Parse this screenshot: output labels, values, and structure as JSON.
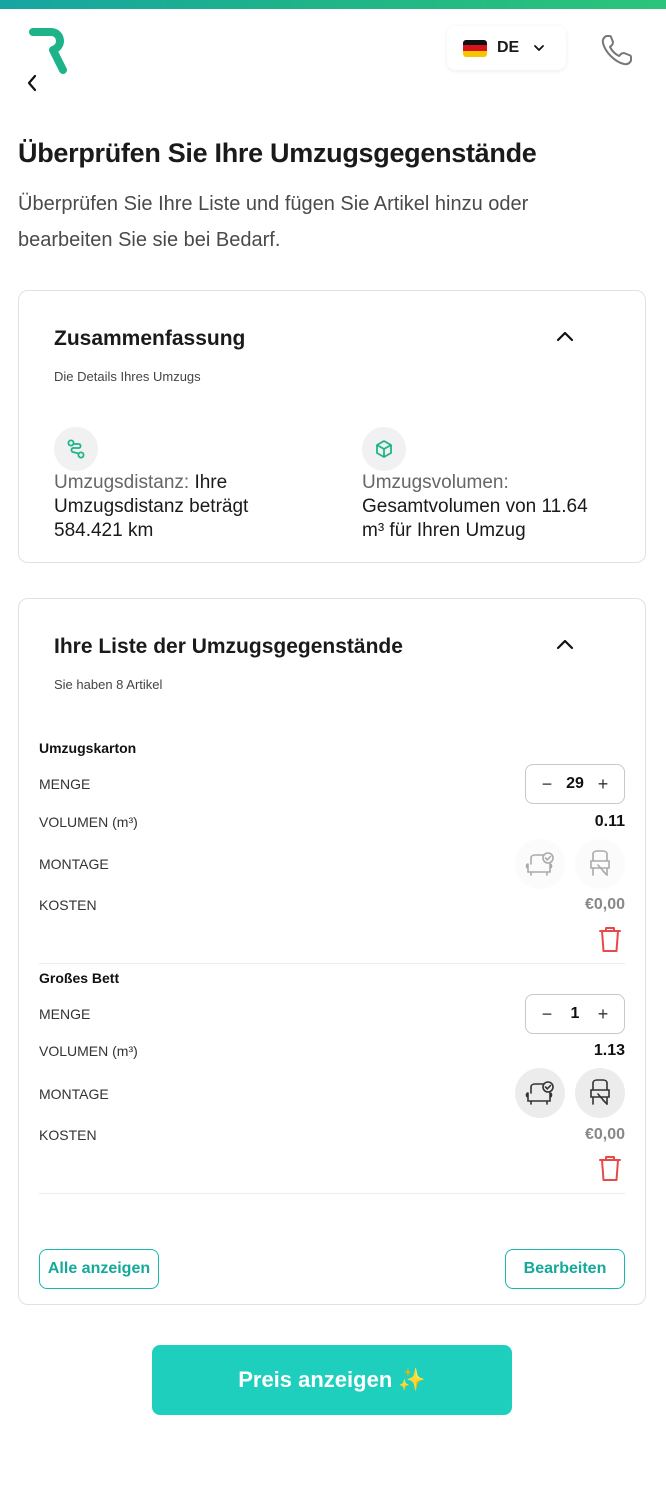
{
  "header": {
    "logo_letter": "R",
    "brand_color": "#1fb389",
    "language": {
      "code": "DE",
      "flag": "germany-flag-icon"
    },
    "back_icon": "chevron-left-icon",
    "phone_icon": "phone-icon"
  },
  "page": {
    "title": "Überprüfen Sie Ihre Umzugsgegenstände",
    "subtitle": "Überprüfen Sie Ihre Liste und fügen Sie Artikel hinzu oder bearbeiten Sie sie bei Bedarf."
  },
  "summary": {
    "title": "Zusammenfassung",
    "subtitle": "Die Details Ihres Umzugs",
    "distance_label": "Umzugsdistanz:",
    "distance_text": " Ihre Umzugsdistanz beträgt 584.421 km",
    "volume_label": "Umzugsvolumen:",
    "volume_text": " Gesamtvolumen von 11.64 m³ für Ihren Umzug"
  },
  "items_list": {
    "title": "Ihre Liste der Umzugsgegenstände",
    "subtitle": "Sie haben 8 Artikel",
    "labels": {
      "quantity": "MENGE",
      "volume": "VOLUMEN (m³)",
      "assembly": "MONTAGE",
      "cost": "KOSTEN"
    },
    "items": [
      {
        "name": "Umzugskarton",
        "quantity": "29",
        "volume": "0.11",
        "cost": "€0,00",
        "assembly_enabled": false
      },
      {
        "name": "Großes Bett",
        "quantity": "1",
        "volume": "1.13",
        "cost": "€0,00",
        "assembly_enabled": true
      }
    ],
    "show_all_label": "Alle anzeigen",
    "edit_label": "Bearbeiten"
  },
  "cta": {
    "label": "Preis anzeigen ✨"
  },
  "colors": {
    "accent": "#1fcfbd",
    "outline_accent": "#14a99b",
    "delete": "#e84a4a"
  }
}
